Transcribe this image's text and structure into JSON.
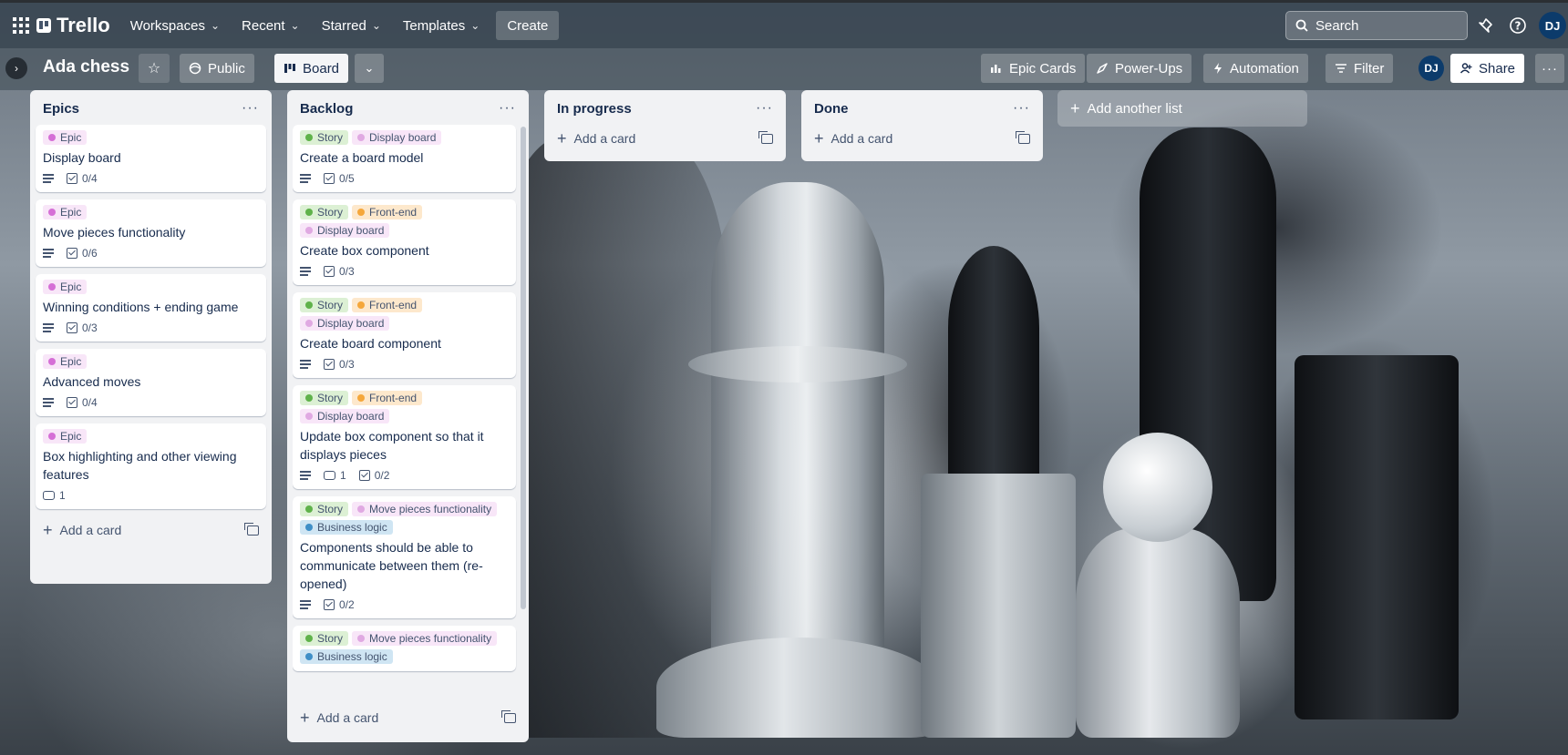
{
  "header": {
    "logo_text": "Trello",
    "nav": [
      {
        "label": "Workspaces"
      },
      {
        "label": "Recent"
      },
      {
        "label": "Starred"
      },
      {
        "label": "Templates"
      }
    ],
    "create_label": "Create",
    "search_placeholder": "Search",
    "avatar_initials": "DJ"
  },
  "board_bar": {
    "title": "Ada chess",
    "visibility_label": "Public",
    "view_label": "Board",
    "epic_cards_label": "Epic Cards",
    "powerups_label": "Power-Ups",
    "automation_label": "Automation",
    "filter_label": "Filter",
    "member_initials": "DJ",
    "share_label": "Share"
  },
  "label_colors": {
    "Epic": {
      "bg": "#f8e6f8",
      "dot": "#d56fd6"
    },
    "Story": {
      "bg": "#dcf0d4",
      "dot": "#5fb24a"
    },
    "Display board": {
      "bg": "#f8e6f8",
      "dot": "#e0a9e2"
    },
    "Front-end": {
      "bg": "#fde8cc",
      "dot": "#f5a73b"
    },
    "Move pieces functionality": {
      "bg": "#f8e6f8",
      "dot": "#e0a9e2"
    },
    "Business logic": {
      "bg": "#cfe5f3",
      "dot": "#3f8fc7"
    }
  },
  "lists": {
    "epics": {
      "title": "Epics",
      "add_card": "Add a card",
      "cards": [
        {
          "labels": [
            "Epic"
          ],
          "title": "Display board",
          "checklist": "0/4"
        },
        {
          "labels": [
            "Epic"
          ],
          "title": "Move pieces functionality",
          "checklist": "0/6"
        },
        {
          "labels": [
            "Epic"
          ],
          "title": "Winning conditions + ending game",
          "checklist": "0/3"
        },
        {
          "labels": [
            "Epic"
          ],
          "title": "Advanced moves",
          "checklist": "0/4"
        },
        {
          "labels": [
            "Epic"
          ],
          "title": "Box highlighting and other viewing features",
          "comments": "1"
        }
      ]
    },
    "backlog": {
      "title": "Backlog",
      "add_card": "Add a card",
      "cards": [
        {
          "labels": [
            "Story",
            "Display board"
          ],
          "title": "Create a board model",
          "checklist": "0/5"
        },
        {
          "labels": [
            "Story",
            "Front-end",
            "Display board"
          ],
          "title": "Create box component",
          "checklist": "0/3"
        },
        {
          "labels": [
            "Story",
            "Front-end",
            "Display board"
          ],
          "title": "Create board component",
          "checklist": "0/3"
        },
        {
          "labels": [
            "Story",
            "Front-end",
            "Display board"
          ],
          "title": "Update box component so that it displays pieces",
          "comments": "1",
          "checklist": "0/2"
        },
        {
          "labels": [
            "Story",
            "Move pieces functionality",
            "Business logic"
          ],
          "title": "Components should be able to communicate between them (re-opened)",
          "checklist": "0/2"
        },
        {
          "labels": [
            "Story",
            "Move pieces functionality",
            "Business logic"
          ],
          "title": ""
        }
      ]
    },
    "in_progress": {
      "title": "In progress",
      "add_card": "Add a card"
    },
    "done": {
      "title": "Done",
      "add_card": "Add a card"
    }
  },
  "add_list_label": "Add another list"
}
